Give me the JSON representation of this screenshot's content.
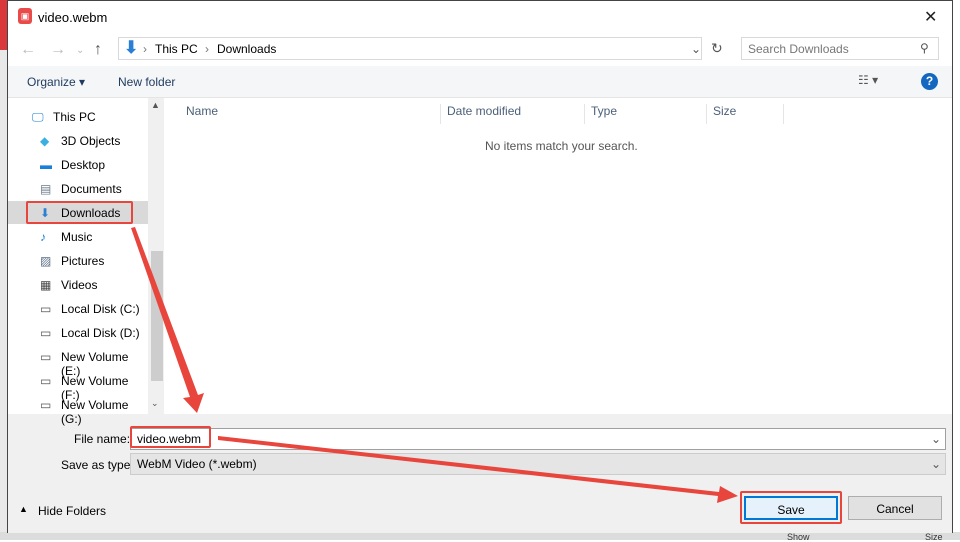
{
  "window": {
    "title": "video.webm",
    "close": "✕"
  },
  "address": {
    "path": [
      "This PC",
      "Downloads"
    ],
    "search_placeholder": "Search Downloads"
  },
  "toolbar": {
    "organize": "Organize ▾",
    "new_folder": "New folder",
    "help": "?"
  },
  "nav_items": [
    {
      "label": "This PC",
      "icon": "pc-icon"
    },
    {
      "label": "3D Objects",
      "icon": "cube-icon"
    },
    {
      "label": "Desktop",
      "icon": "desktop-icon"
    },
    {
      "label": "Documents",
      "icon": "document-icon"
    },
    {
      "label": "Downloads",
      "icon": "download-icon"
    },
    {
      "label": "Music",
      "icon": "music-icon"
    },
    {
      "label": "Pictures",
      "icon": "picture-icon"
    },
    {
      "label": "Videos",
      "icon": "video-icon"
    },
    {
      "label": "Local Disk (C:)",
      "icon": "disk-icon"
    },
    {
      "label": "Local Disk (D:)",
      "icon": "disk-icon"
    },
    {
      "label": "New Volume (E:)",
      "icon": "disk-icon"
    },
    {
      "label": "New Volume (F:)",
      "icon": "disk-icon"
    },
    {
      "label": "New Volume (G:)",
      "icon": "disk-icon"
    }
  ],
  "columns": [
    "Name",
    "Date modified",
    "Type",
    "Size"
  ],
  "empty_message": "No items match your search.",
  "form": {
    "file_name_label": "File name:",
    "file_name": "video.webm",
    "type_label": "Save as type:",
    "type_value": "WebM Video (*.webm)"
  },
  "buttons": {
    "hide_folders": "Hide Folders",
    "save": "Save",
    "cancel": "Cancel"
  },
  "background": {
    "show": "Show",
    "size": "Size"
  },
  "colors": {
    "accent": "#0078d7",
    "annotation": "#e8453c"
  }
}
